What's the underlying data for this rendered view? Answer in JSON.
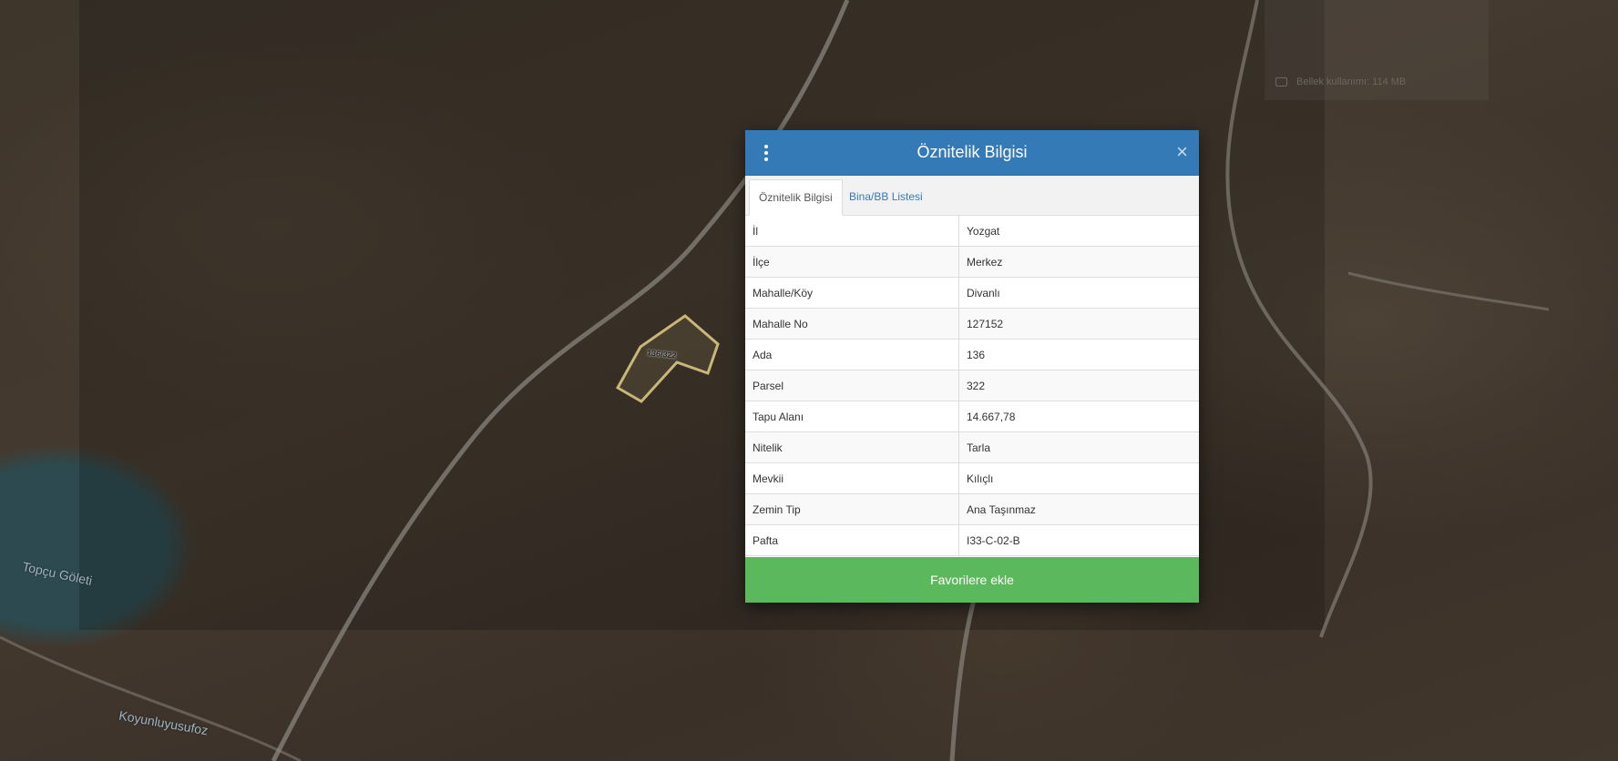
{
  "map": {
    "labels": {
      "pond": "Topçu Göleti",
      "village": "Koyunluyusufoz",
      "parcel": "136/322"
    },
    "memory": "Bellek kullanımı: 114 MB",
    "colors": {
      "parcel_outline": "#c9b77a",
      "road": "#8d8a83"
    }
  },
  "modal": {
    "title": "Öznitelik Bilgisi",
    "menu_icon": "vertical-dots-icon",
    "close_label": "×",
    "tabs": [
      {
        "label": "Öznitelik Bilgisi",
        "active": true
      },
      {
        "label": "Bina/BB Listesi",
        "active": false
      }
    ],
    "attributes": [
      {
        "key": "İl",
        "value": "Yozgat"
      },
      {
        "key": "İlçe",
        "value": "Merkez"
      },
      {
        "key": "Mahalle/Köy",
        "value": "Divanlı"
      },
      {
        "key": "Mahalle No",
        "value": "127152"
      },
      {
        "key": "Ada",
        "value": "136"
      },
      {
        "key": "Parsel",
        "value": "322"
      },
      {
        "key": "Tapu Alanı",
        "value": "14.667,78"
      },
      {
        "key": "Nitelik",
        "value": "Tarla"
      },
      {
        "key": "Mevkii",
        "value": "Kılıçlı"
      },
      {
        "key": "Zemin Tip",
        "value": "Ana Taşınmaz"
      },
      {
        "key": "Pafta",
        "value": "I33-C-02-B"
      }
    ],
    "favorite_button": "Favorilere ekle",
    "colors": {
      "header": "#337ab7",
      "button": "#5cb85c"
    }
  }
}
